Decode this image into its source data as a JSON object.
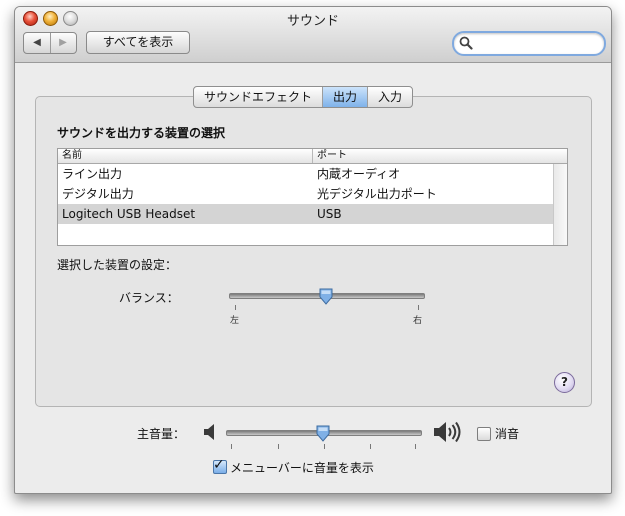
{
  "window": {
    "title": "サウンド"
  },
  "toolbar": {
    "back_glyph": "◀",
    "forward_glyph": "▶",
    "show_all_label": "すべてを表示",
    "search": {
      "value": "",
      "placeholder": ""
    }
  },
  "tabs": [
    {
      "label": "サウンドエフェクト",
      "selected": false
    },
    {
      "label": "出力",
      "selected": true
    },
    {
      "label": "入力",
      "selected": false
    }
  ],
  "output": {
    "section_title": "サウンドを出力する装置の選択",
    "columns": {
      "name": "名前",
      "port": "ポート"
    },
    "devices": [
      {
        "name": "ライン出力",
        "port": "内蔵オーディオ",
        "selected": false
      },
      {
        "name": "デジタル出力",
        "port": "光デジタル出力ポート",
        "selected": false
      },
      {
        "name": "Logitech USB Headset",
        "port": "USB",
        "selected": true
      }
    ],
    "settings_label": "選択した装置の設定：",
    "balance": {
      "label": "バランス：",
      "left_label": "左",
      "right_label": "右",
      "value": 0.5
    }
  },
  "help_glyph": "?",
  "volume": {
    "label": "主音量：",
    "value": 0.5,
    "mute_label": "消音",
    "muted": false,
    "show_in_menubar_label": "メニューバーに音量を表示",
    "show_in_menubar": true,
    "check_glyph": "✓"
  },
  "icons": {
    "search": "magnifier-icon",
    "speaker_low": "speaker-low-icon",
    "speaker_high": "speaker-high-icon",
    "help": "help-icon"
  },
  "colors": {
    "tab_selected": "#7fb2ea",
    "search_focus": "#7fa9df",
    "close": "#e8513a",
    "minimize": "#f0b23a"
  }
}
